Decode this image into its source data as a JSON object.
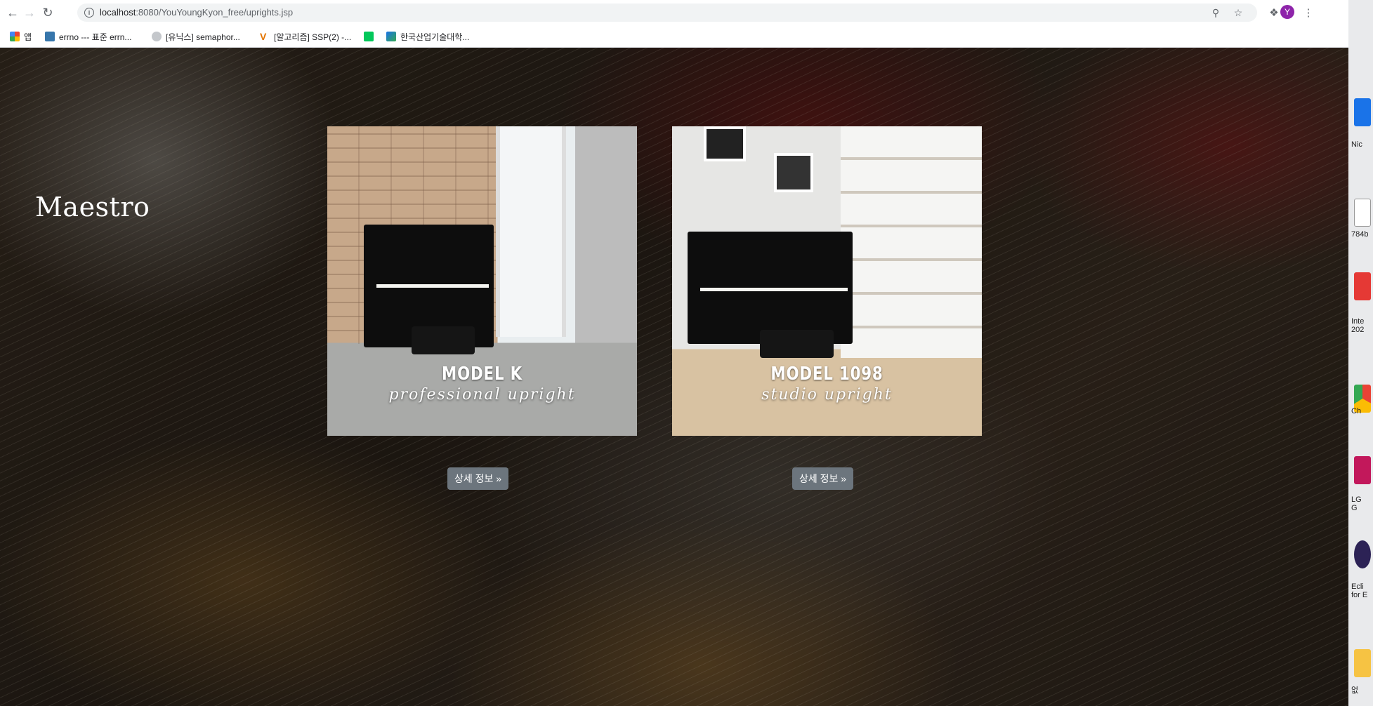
{
  "browser": {
    "url_host": "localhost",
    "url_rest": ":8080/YouYoungKyon_free/uprights.jsp",
    "avatar_letter": "Y",
    "bookmarks": [
      {
        "label": "앱",
        "color": "#ea4335"
      },
      {
        "label": "errno --- 표준 errn...",
        "color": "#3776ab"
      },
      {
        "label": "[유닉스] semaphor...",
        "color": "#9aa0a6"
      },
      {
        "label": "[알고리즘] SSP(2) -...",
        "color": "#e37400"
      },
      {
        "label": "",
        "color": "#03c75a"
      },
      {
        "label": "한국산업기술대학...",
        "color": "#1a73e8"
      }
    ]
  },
  "page": {
    "brand": "Maestro",
    "cards": [
      {
        "model": "MODEL K",
        "subtitle": "professional upright",
        "button": "상세 정보 »"
      },
      {
        "model": "MODEL 1098",
        "subtitle": "studio upright",
        "button": "상세 정보 »"
      }
    ]
  },
  "desktop": {
    "labels": [
      "Nic",
      "784b",
      "Inte\n202",
      "Ch",
      "LG\nG",
      "Ecli\nfor E",
      "없"
    ]
  }
}
